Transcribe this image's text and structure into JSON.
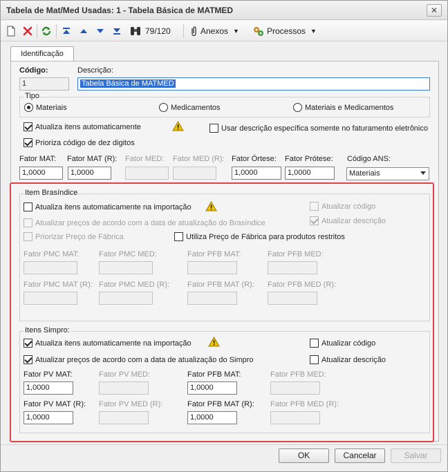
{
  "window": {
    "title": "Tabela de Mat/Med Usadas: 1 - Tabela Básica de MATMED",
    "close_glyph": "✕"
  },
  "toolbar": {
    "record_position": "79/120",
    "anexos_label": "Anexos",
    "processos_label": "Processos",
    "icons": [
      "new-document-icon",
      "delete-icon",
      "refresh-icon",
      "first-record-icon",
      "previous-record-icon",
      "next-record-icon",
      "last-record-icon",
      "binoculars-icon",
      "paperclip-icon",
      "gears-icon"
    ]
  },
  "tabs": [
    {
      "label": "Identificação",
      "active": true
    }
  ],
  "header": {
    "codigo_label": "Código:",
    "codigo_value": "1",
    "descricao_label": "Descrição:",
    "descricao_value": "Tabela Básica de MATMED"
  },
  "tipo": {
    "title": "Tipo",
    "options": [
      "Materiais",
      "Medicamentos",
      "Materiais e Medicamentos"
    ],
    "selected": "Materiais"
  },
  "options": {
    "atualiza_itens": {
      "label": "Atualiza itens automaticamente",
      "checked": true
    },
    "usar_descricao": {
      "label": "Usar descrição específica somente no faturamento eletrônico",
      "checked": false
    },
    "prioriza_codigo": {
      "label": "Prioriza código de dez digitos",
      "checked": true
    }
  },
  "fatores": {
    "fator_mat": {
      "label": "Fator MAT:",
      "value": "1,0000"
    },
    "fator_mat_r": {
      "label": "Fator MAT (R):",
      "value": "1,0000"
    },
    "fator_med": {
      "label": "Fator MED:",
      "value": ""
    },
    "fator_med_r": {
      "label": "Fator MED (R):",
      "value": ""
    },
    "fator_ortese": {
      "label": "Fator Órtese:",
      "value": "1,0000"
    },
    "fator_protese": {
      "label": "Fator Prótese:",
      "value": "1,0000"
    },
    "codigo_ans": {
      "label": "Código ANS:",
      "value": "Materiais"
    }
  },
  "brasindice": {
    "title": "Item Brasíndice",
    "atualiza_importacao": {
      "label": "Atualiza itens automaticamente na importação",
      "checked": false
    },
    "atualizar_precos": {
      "label": "Atualizar preços de acordo com a data de atualização do Brasíndice",
      "checked": false
    },
    "priorizar_preco": {
      "label": "Priorizar Preço de Fábrica",
      "checked": false
    },
    "utiliza_preco": {
      "label": "Utiliza Preço de Fábrica para produtos restritos",
      "checked": false
    },
    "atualizar_codigo": {
      "label": "Atualizar código",
      "checked": false
    },
    "atualizar_descricao": {
      "label": "Atualizar descrição",
      "checked": true
    },
    "fator_pmc_mat": {
      "label": "Fator PMC MAT:",
      "value": ""
    },
    "fator_pmc_med": {
      "label": "Fator PMC MED:",
      "value": ""
    },
    "fator_pfb_mat": {
      "label": "Fator PFB MAT:",
      "value": ""
    },
    "fator_pfb_med": {
      "label": "Fator PFB MED:",
      "value": ""
    },
    "fator_pmc_mat_r": {
      "label": "Fator PMC MAT (R):",
      "value": ""
    },
    "fator_pmc_med_r": {
      "label": "Fator PMC MED (R):",
      "value": ""
    },
    "fator_pfb_mat_r": {
      "label": "Fator PFB MAT (R):",
      "value": ""
    },
    "fator_pfb_med_r": {
      "label": "Fator PFB MED (R):",
      "value": ""
    }
  },
  "simpro": {
    "title": "Itens Simpro:",
    "atualiza_importacao": {
      "label": "Atualiza itens automaticamente na importação",
      "checked": true
    },
    "atualizar_precos": {
      "label": "Atualizar preços de acordo com a data de atualização do Simpro",
      "checked": true
    },
    "atualizar_codigo": {
      "label": "Atualizar código",
      "checked": false
    },
    "atualizar_descricao": {
      "label": "Atualizar descrição",
      "checked": false
    },
    "fator_pv_mat": {
      "label": "Fator PV MAT:",
      "value": "1,0000"
    },
    "fator_pv_med": {
      "label": "Fator PV MED:",
      "value": ""
    },
    "fator_pfb_mat": {
      "label": "Fator PFB MAT:",
      "value": "1,0000"
    },
    "fator_pfb_med": {
      "label": "Fator PFB MED:",
      "value": ""
    },
    "fator_pv_mat_r": {
      "label": "Fator PV MAT (R):",
      "value": "1,0000"
    },
    "fator_pv_med_r": {
      "label": "Fator PV MED (R):",
      "value": ""
    },
    "fator_pfb_mat_r": {
      "label": "Fator PFB MAT (R):",
      "value": "1,0000"
    },
    "fator_pfb_med_r": {
      "label": "Fator PFB MED (R):",
      "value": ""
    }
  },
  "footer": {
    "ok_label": "OK",
    "cancel_label": "Cancelar",
    "save_label": "Salvar"
  },
  "colors": {
    "highlight_frame": "#e0424a",
    "selection": "#2f6fd3",
    "warning": "#f2c200"
  }
}
